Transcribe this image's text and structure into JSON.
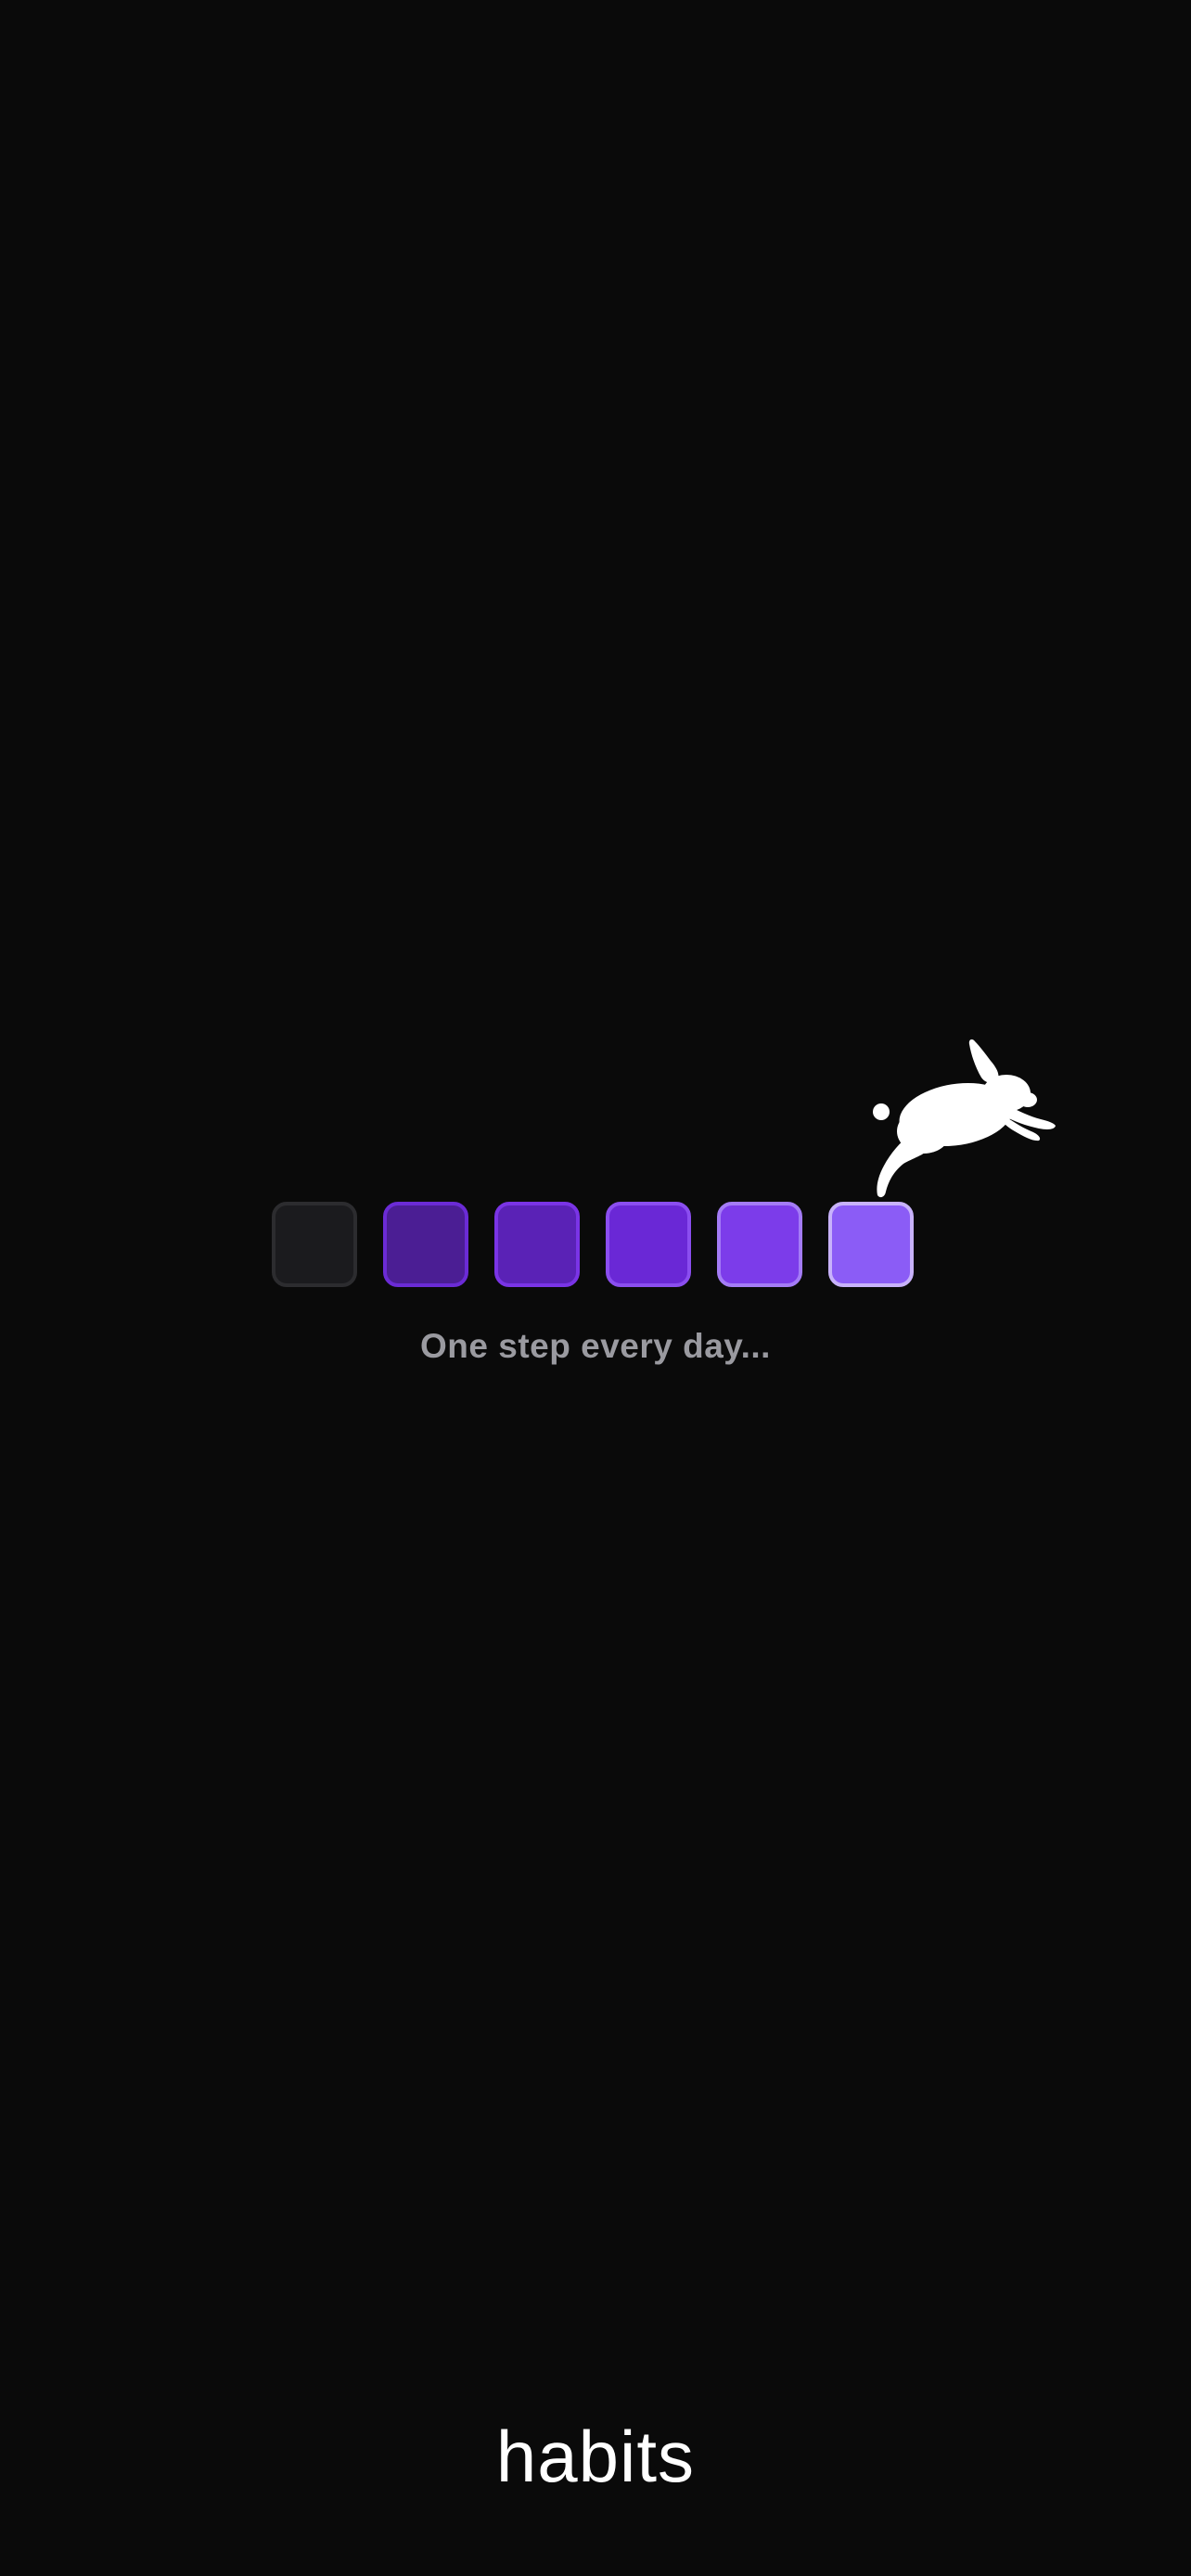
{
  "splash": {
    "tagline": "One step every day...",
    "app_name": "habits",
    "mascot_icon": "rabbit-icon",
    "steps": [
      {
        "fill": "#1b1b1e",
        "border": "#2c2c2f"
      },
      {
        "fill": "#4b1e94",
        "border": "#6b2bd6"
      },
      {
        "fill": "#5a22b6",
        "border": "#7a34e6"
      },
      {
        "fill": "#6a28d6",
        "border": "#8b4ef0"
      },
      {
        "fill": "#7c3cea",
        "border": "#a47cf6"
      },
      {
        "fill": "#8b5cf6",
        "border": "#c8b2fb"
      }
    ],
    "colors": {
      "background": "#0a0a0a",
      "tagline": "#9a9aa0",
      "app_name": "#ffffff",
      "mascot": "#ffffff"
    }
  }
}
